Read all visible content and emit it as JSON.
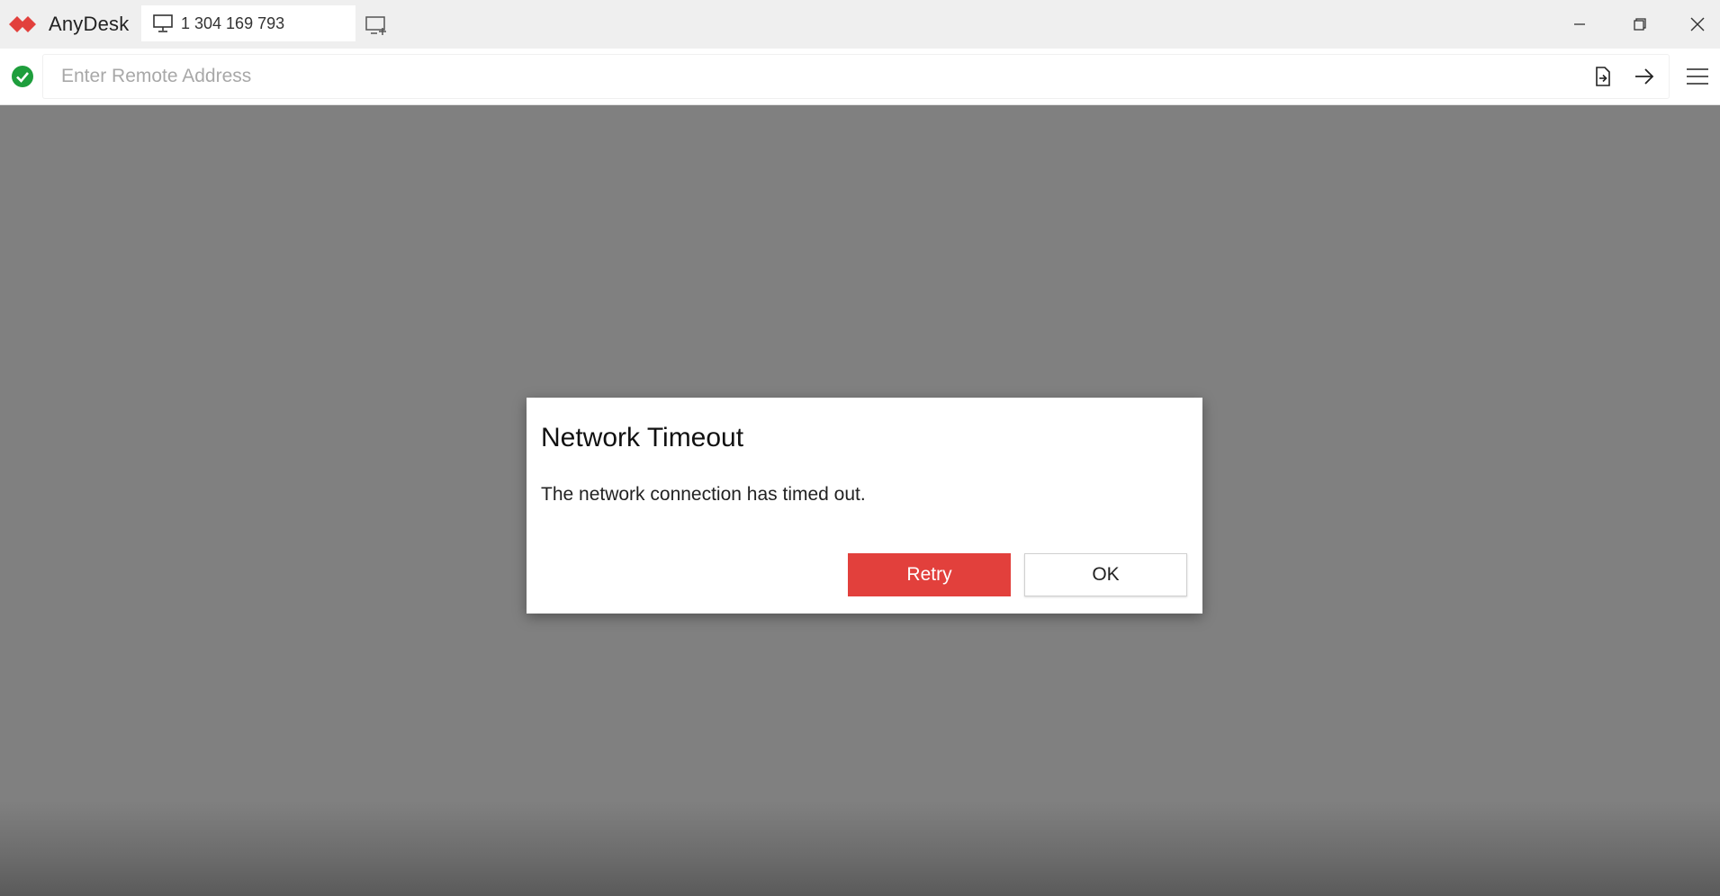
{
  "app": {
    "name": "AnyDesk",
    "brand_color": "#e2403c"
  },
  "tabs": [
    {
      "label": "1 304 169 793",
      "icon": "monitor-icon"
    }
  ],
  "titlebar": {
    "new_tab_icon": "new-tab-icon",
    "controls": [
      "minimize-icon",
      "restore-icon",
      "close-icon"
    ]
  },
  "addressbar": {
    "status_icon": "check-circle-icon",
    "status_color": "#1e9e3c",
    "value": "",
    "placeholder": "Enter Remote Address",
    "actions": [
      "file-transfer-icon",
      "connect-arrow-icon",
      "menu-icon"
    ]
  },
  "dialog": {
    "title": "Network Timeout",
    "message": "The network connection has timed out.",
    "retry_label": "Retry",
    "ok_label": "OK"
  }
}
